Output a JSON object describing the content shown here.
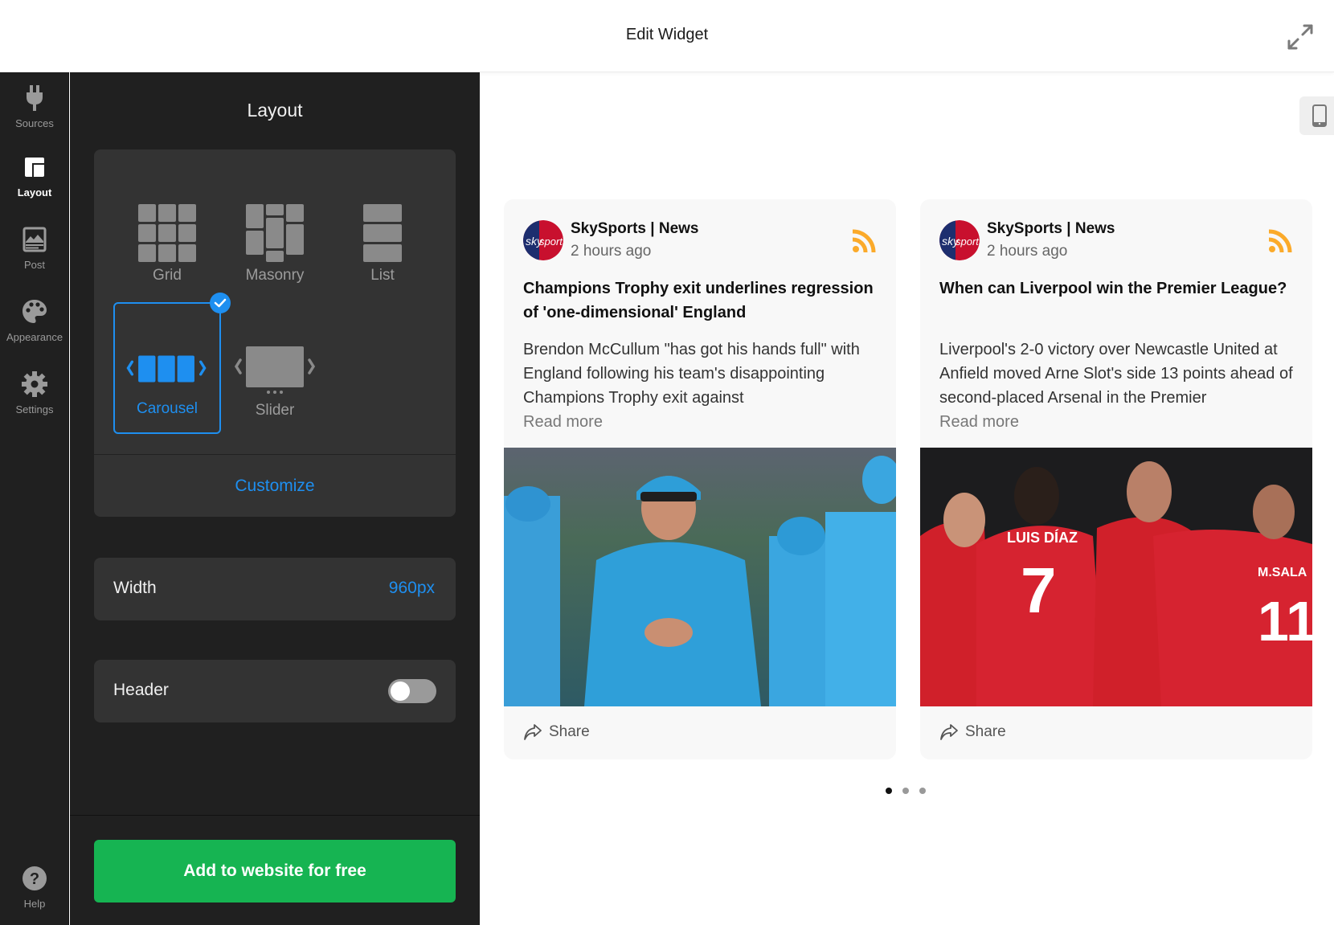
{
  "header": {
    "title": "Edit Widget",
    "expand_icon": "expand-arrows-icon"
  },
  "rail": {
    "items": [
      {
        "label": "Sources",
        "icon": "plug-icon",
        "active": false
      },
      {
        "label": "Layout",
        "icon": "layout-icon",
        "active": true
      },
      {
        "label": "Post",
        "icon": "image-icon",
        "active": false
      },
      {
        "label": "Appearance",
        "icon": "palette-icon",
        "active": false
      },
      {
        "label": "Settings",
        "icon": "gear-icon",
        "active": false
      }
    ],
    "help": {
      "label": "Help",
      "icon": "question-circle-icon"
    }
  },
  "panel": {
    "title": "Layout",
    "layout_options": [
      {
        "label": "Grid",
        "selected": false
      },
      {
        "label": "Masonry",
        "selected": false
      },
      {
        "label": "List",
        "selected": false
      },
      {
        "label": "Carousel",
        "selected": true
      },
      {
        "label": "Slider",
        "selected": false
      }
    ],
    "customize_label": "Customize",
    "width": {
      "label": "Width",
      "value": "960px"
    },
    "header_toggle": {
      "label": "Header",
      "on": false
    },
    "cta_label": "Add to website for free"
  },
  "colors": {
    "accent": "#1e8ff0",
    "cta": "#16b452",
    "rss": "#fbaa2a",
    "panel_bg": "#202020",
    "card_bg": "#333333"
  },
  "preview": {
    "device_icon": "mobile-phone-icon",
    "posts": [
      {
        "author": "SkySports | News",
        "time": "2 hours ago",
        "headline": "Champions Trophy exit underlines regression of 'one-dimensional' England",
        "excerpt": "Brendon McCullum \"has got his hands full\" with England following his team's disappointing Champions Trophy exit against",
        "read_more": "Read more",
        "share_label": "Share",
        "image_alt": "England cricket players in blue kit on the field"
      },
      {
        "author": "SkySports | News",
        "time": "2 hours ago",
        "headline": "When can Liverpool win the Premier League?",
        "excerpt": "Liverpool's 2-0 victory over Newcastle United at Anfield moved Arne Slot's side 13 points ahead of second-placed Arsenal in the Premier",
        "read_more": "Read more",
        "share_label": "Share",
        "image_alt": "Liverpool players in red kit celebrating"
      }
    ],
    "pagination": {
      "pages": 3,
      "current": 1
    }
  }
}
